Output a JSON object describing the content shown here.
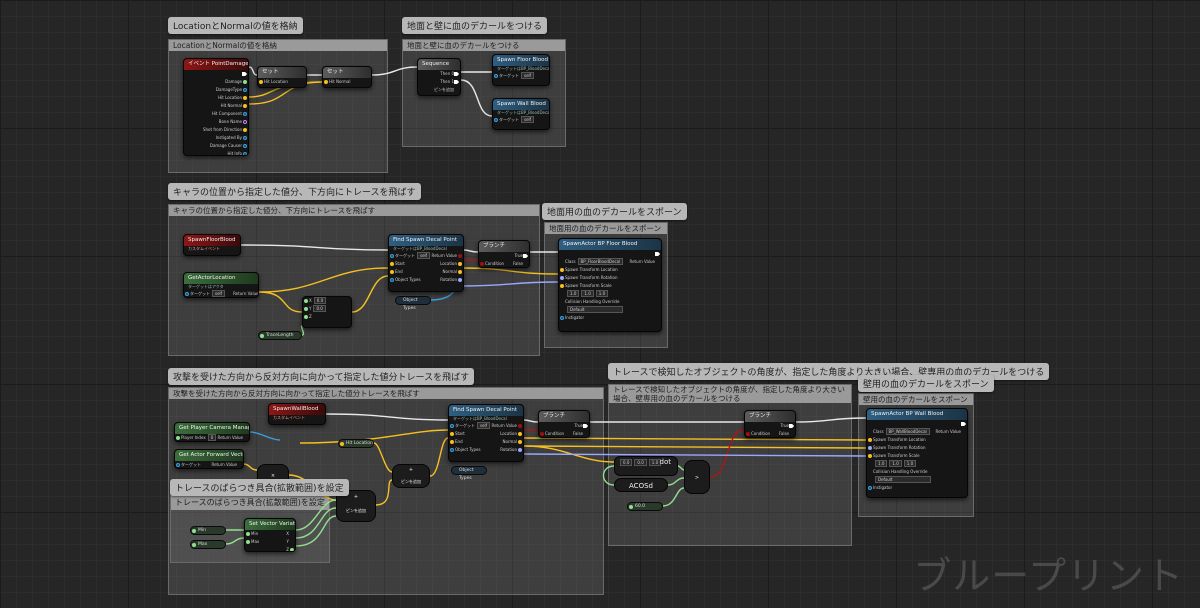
{
  "watermark": "ブループリント",
  "comments": [
    {
      "bar": "LocationとNormalの値を格納",
      "bubble": "LocationとNormalの値を格納"
    },
    {
      "bar": "地面と壁に血のデカールをつける",
      "bubble": "地面と壁に血のデカールをつける"
    },
    {
      "bar": "キャラの位置から指定した値分、下方向にトレースを飛ばす",
      "bubble": "キャラの位置から指定した値分、下方向にトレースを飛ばす"
    },
    {
      "bar": "地面用の血のデカールをスポーン",
      "bubble": "地面用の血のデカールをスポーン"
    },
    {
      "bar": "攻撃を受けた方向から反対方向に向かって指定した値分トレースを飛ばす",
      "bubble": "攻撃を受けた方向から反対方向に向かって指定した値分トレースを飛ばす"
    },
    {
      "bar": "トレースで検知したオブジェクトの角度が、指定した角度より大きい場合、壁専用の血のデカールをつける",
      "bubble": "トレースで検知したオブジェクトの角度が、指定した角度より大きい場合、壁専用の血のデカールをつける"
    },
    {
      "bar": "壁用の血のデカールをスポーン",
      "bubble": "壁用の血のデカールをスポーン"
    },
    {
      "bar": "トレースのばらつき具合(拡散範囲)を設定",
      "bubble": "トレースのばらつき具合(拡散範囲)を設定"
    }
  ],
  "nodes": {
    "event": {
      "title": "イベント PointDamage",
      "pins": [
        "Damage",
        "DamageType",
        "Hit Location",
        "Hit Normal",
        "Hit Component",
        "Bone Name",
        "Shot from Direction",
        "Instigated By",
        "Damage Causer",
        "Hit Info"
      ]
    },
    "set1": {
      "title": "セット",
      "pin": "Hit Location"
    },
    "set2": {
      "title": "セット",
      "pin": "Hit Normal"
    },
    "sequence": {
      "title": "Sequence",
      "pins": [
        "Then 0",
        "Then 1",
        "ピンを追加"
      ]
    },
    "spawn_floor": {
      "title": "Spawn Floor Blood",
      "sub": "ターゲットはBP_BloodDecal",
      "target": "ターゲット",
      "self": "self"
    },
    "spawn_wall": {
      "title": "Spawn Wall Blood",
      "sub": "ターゲットはBP_BloodDecal",
      "target": "ターゲット",
      "self": "self"
    },
    "floor_event": {
      "title": "SpawnFloorBlood",
      "sub": "カスタムイベント"
    },
    "get_actor_loc": {
      "title": "GetActorLocation",
      "sub": "ターゲットはアクタ",
      "target": "ターゲット",
      "self": "self",
      "ret": "Return Value"
    },
    "find_decal_1": {
      "title": "Find Spawn Decal Point",
      "sub": "ターゲットはBP_BloodDecal",
      "pins_l": [
        "ターゲット",
        "Start",
        "End",
        "Object Types"
      ],
      "pins_r": [
        "Return Value",
        "Location",
        "Normal",
        "Rotation"
      ],
      "self": "self"
    },
    "branch_1": {
      "title": "ブランチ",
      "cond": "Condition",
      "t": "True",
      "f": "False"
    },
    "vec_xy": {
      "x": "X",
      "y": "Y",
      "z": "Z",
      "xv": "0.0",
      "yv": "0.0"
    },
    "trace_len_1": {
      "label": "TraceLength"
    },
    "object_types_1": {
      "label": "Object Types"
    },
    "spawn_floor_actor": {
      "title": "SpawnActor BP Floor Blood",
      "class_label": "Class",
      "class_val": "BP_FloorBloodDecal",
      "ret": "Return Value",
      "pins": [
        "Spawn Transform Location",
        "Spawn Transform Rotation",
        "Spawn Transform Scale"
      ],
      "scale": [
        "1.0",
        "1.0",
        "1.0"
      ],
      "collision": "Collision Handling Override",
      "collision_val": "Default",
      "owner": "Instigator"
    },
    "wall_event": {
      "title": "SpawnWallBlood",
      "sub": "カスタムイベント"
    },
    "get_cam_mgr": {
      "title": "Get Player Camera Manager",
      "pin": "Player Index",
      "val": "0",
      "ret": "Return Value"
    },
    "get_fwd": {
      "title": "Get Actor Forward Vector",
      "target": "ターゲット",
      "ret": "Return Value"
    },
    "hit_loc_var": {
      "label": "Hit Location"
    },
    "multiply": {
      "label": "×"
    },
    "add_1": {
      "label": "+",
      "pin": "ピンを追加"
    },
    "add_2": {
      "label": "+",
      "pin": "ピンを追加"
    },
    "rand_vec": {
      "title": "Set Vector Variation",
      "pins_l": [
        "Min",
        "Max"
      ],
      "pins_r": [
        "X",
        "Y",
        "Z"
      ]
    },
    "min_var": {
      "label": "Min"
    },
    "max_var": {
      "label": "Max"
    },
    "find_decal_2": {
      "title": "Find Spawn Decal Point",
      "sub": "ターゲットはBP_BloodDecal",
      "pins_l": [
        "ターゲット",
        "Start",
        "End",
        "Object Types"
      ],
      "pins_r": [
        "Return Value",
        "Location",
        "Normal",
        "Rotation"
      ],
      "self": "self"
    },
    "object_types_2": {
      "label": "Object Types"
    },
    "dot_prod": {
      "vals": [
        "0.0",
        "0.0",
        "1.0"
      ],
      "label": "dot"
    },
    "acos": {
      "label": "ACOSd"
    },
    "angle_var": {
      "label": "60.0"
    },
    "greater": {
      "label": ">"
    },
    "branch_2": {
      "title": "ブランチ",
      "cond": "Condition",
      "t": "True",
      "f": "False"
    },
    "spawn_wall_actor": {
      "title": "SpawnActor BP Wall Blood",
      "class_label": "Class",
      "class_val": "BP_WallBloodDecal",
      "ret": "Return Value",
      "pins": [
        "Spawn Transform Location",
        "Spawn Transform Rotation",
        "Spawn Transform Scale"
      ],
      "scale": [
        "1.0",
        "1.0",
        "1.0"
      ],
      "collision": "Collision Handling Override",
      "collision_val": "Default",
      "owner": "Instigator"
    }
  }
}
